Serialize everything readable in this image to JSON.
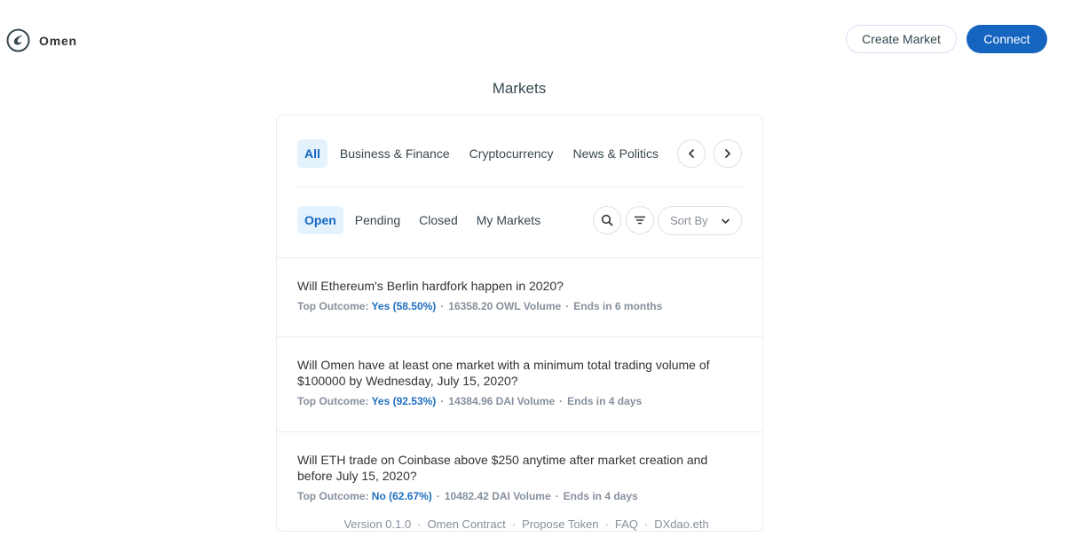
{
  "header": {
    "logo_text": "Omen",
    "create_market_label": "Create Market",
    "connect_label": "Connect"
  },
  "page": {
    "title": "Markets"
  },
  "categories": [
    {
      "label": "All",
      "active": true
    },
    {
      "label": "Business & Finance",
      "active": false
    },
    {
      "label": "Cryptocurrency",
      "active": false
    },
    {
      "label": "News & Politics",
      "active": false
    }
  ],
  "states": [
    {
      "label": "Open",
      "active": true
    },
    {
      "label": "Pending",
      "active": false
    },
    {
      "label": "Closed",
      "active": false
    },
    {
      "label": "My Markets",
      "active": false
    }
  ],
  "sort": {
    "label": "Sort By"
  },
  "markets": [
    {
      "title": "Will Ethereum's Berlin hardfork happen in 2020?",
      "outcome_prefix": "Top Outcome:",
      "outcome": "Yes (58.50%)",
      "volume": "16358.20 OWL Volume",
      "ends": "Ends in 6 months"
    },
    {
      "title": "Will Omen have at least one market with a minimum total trading volume of $100000 by Wednesday, July 15, 2020?",
      "outcome_prefix": "Top Outcome:",
      "outcome": "Yes (92.53%)",
      "volume": "14384.96 DAI Volume",
      "ends": "Ends in 4 days"
    },
    {
      "title": "Will ETH trade on Coinbase above $250 anytime after market creation and before July 15, 2020?",
      "outcome_prefix": "Top Outcome:",
      "outcome": "No (62.67%)",
      "volume": "10482.42 DAI Volume",
      "ends": "Ends in 4 days"
    }
  ],
  "footer": {
    "version": "Version 0.1.0",
    "links": [
      "Omen Contract",
      "Propose Token",
      "FAQ",
      "DXdao.eth"
    ],
    "separator": "·"
  },
  "colors": {
    "primary": "#1565c0",
    "active_bg": "#e3f2fd",
    "outcome": "#1e6fbf"
  },
  "icons": {
    "logo": "omen-logo-icon",
    "prev": "chevron-left-icon",
    "next": "chevron-right-icon",
    "search": "search-icon",
    "filter": "filter-icon",
    "sort": "chevron-down-icon"
  }
}
